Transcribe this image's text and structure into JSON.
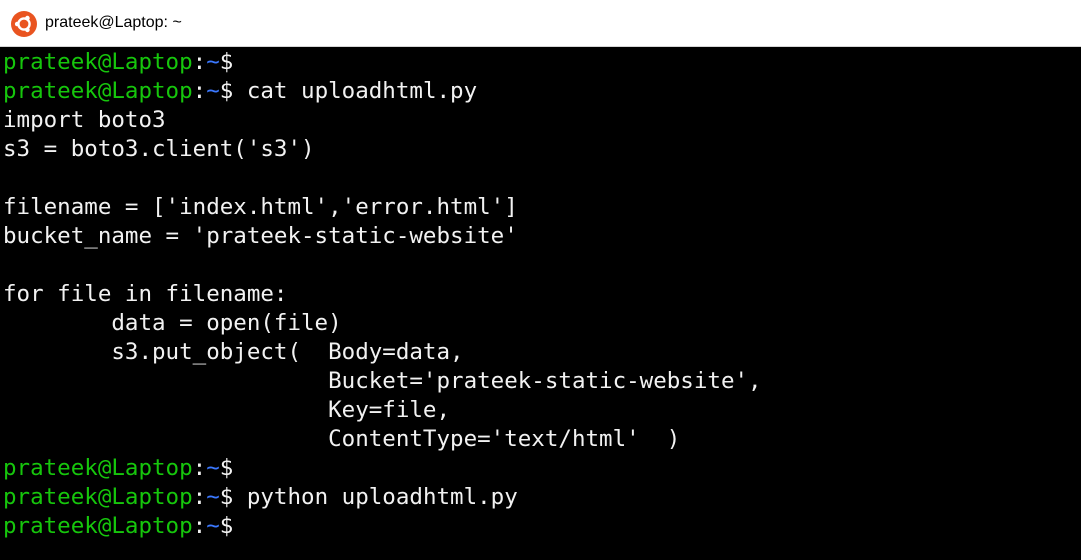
{
  "window": {
    "title": "prateek@Laptop: ~",
    "icon": "ubuntu-icon",
    "icon_color": "#e95420"
  },
  "colors": {
    "background": "#000000",
    "prompt_user": "#16c60c",
    "prompt_path": "#3b78ff",
    "text": "#f2f2f2"
  },
  "terminal": {
    "prompt": {
      "user_host": "prateek@Laptop",
      "colon": ":",
      "path": "~",
      "symbol": "$"
    },
    "commands": {
      "c1": "",
      "c2": " cat uploadhtml.py",
      "c3": "",
      "c4": " python uploadhtml.py",
      "c5": ""
    },
    "output": [
      "import boto3",
      "s3 = boto3.client('s3')",
      "",
      "filename = ['index.html','error.html']",
      "bucket_name = 'prateek-static-website'",
      "",
      "for file in filename:",
      "        data = open(file)",
      "        s3.put_object(  Body=data,",
      "                        Bucket='prateek-static-website',",
      "                        Key=file,",
      "                        ContentType='text/html'  )"
    ]
  }
}
